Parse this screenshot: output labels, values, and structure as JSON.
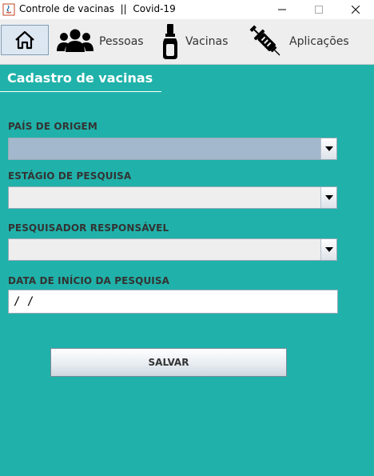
{
  "window": {
    "title": "Controle de vacinas  ||  Covid-19"
  },
  "nav": {
    "home_icon": "home-icon",
    "items": [
      {
        "label": "Pessoas",
        "icon": "people-icon"
      },
      {
        "label": "Vacinas",
        "icon": "vaccine-vial-icon"
      },
      {
        "label": "Aplicações",
        "icon": "syringe-icon"
      }
    ]
  },
  "form": {
    "title": "Cadastro de vacinas",
    "fields": [
      {
        "label": "PAÍS DE ORIGEM",
        "value": ""
      },
      {
        "label": "ESTÁGIO DE PESQUISA",
        "value": ""
      },
      {
        "label": "PESQUISADOR RESPONSÁVEL",
        "value": ""
      },
      {
        "label": "DATA DE INÍCIO DA PESQUISA",
        "value": " / /"
      }
    ],
    "save_label": "SALVAR"
  },
  "colors": {
    "background": "#20b2aa",
    "navbar": "#eeeeee",
    "selected_combo": "#a3b8cc"
  }
}
